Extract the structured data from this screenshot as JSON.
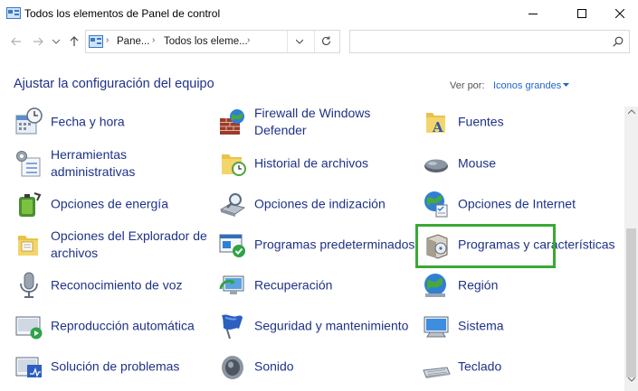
{
  "window": {
    "title": "Todos los elementos de Panel de control"
  },
  "nav": {
    "breadcrumbs": [
      "Pane...",
      "Todos los eleme..."
    ],
    "search_placeholder": ""
  },
  "header": {
    "title": "Ajustar la configuración del equipo",
    "view_by_label": "Ver por:",
    "view_by_value": "Iconos grandes"
  },
  "items": {
    "fecha": "Fecha y hora",
    "firewall": "Firewall de Windows Defender",
    "fuentes": "Fuentes",
    "herramientas": "Herramientas administrativas",
    "historial": "Historial de archivos",
    "mouse": "Mouse",
    "energia": "Opciones de energía",
    "indizacion": "Opciones de indización",
    "internet": "Opciones de Internet",
    "explorador": "Opciones del Explorador de archivos",
    "predeterminados": "Programas predeterminados",
    "programas": "Programas y características",
    "voz": "Reconocimiento de voz",
    "recuperacion": "Recuperación",
    "region": "Región",
    "reproduccion": "Reproducción automática",
    "seguridad": "Seguridad y mantenimiento",
    "sistema": "Sistema",
    "solucion": "Solución de problemas",
    "sonido": "Sonido",
    "teclado": "Teclado"
  },
  "colors": {
    "link": "#1e3287",
    "highlight": "#3aa935",
    "accent": "#1e66c8"
  },
  "icons": [
    "clock-icon",
    "firewall-icon",
    "fonts-folder-icon",
    "tools-icon",
    "file-history-icon",
    "mouse-icon",
    "power-icon",
    "indexing-icon",
    "internet-icon",
    "explorer-options-icon",
    "default-programs-icon",
    "programs-icon",
    "microphone-icon",
    "recovery-icon",
    "region-icon",
    "autoplay-icon",
    "security-flag-icon",
    "system-icon",
    "troubleshoot-icon",
    "speaker-icon",
    "keyboard-icon"
  ]
}
